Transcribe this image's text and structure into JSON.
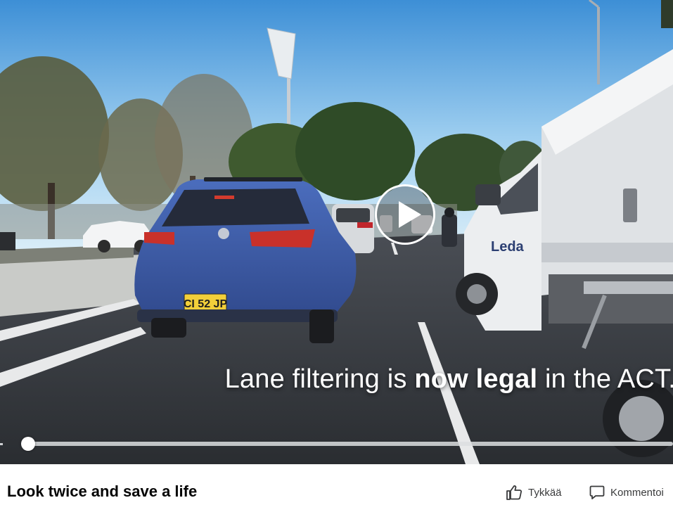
{
  "video": {
    "caption_prefix": "Lane filtering is ",
    "caption_bold": "now legal",
    "caption_suffix": " in the ACT.",
    "number_plate": "CI 52 JP",
    "truck_brand": "Leda",
    "progress": 0.0
  },
  "post": {
    "title": "Look twice and save a life",
    "like_label": "Tykkää",
    "comment_label": "Kommentoi"
  },
  "colors": {
    "sky_top": "#3d8fd6",
    "road": "#34373c",
    "car_blue": "#3e5eae",
    "truck_white": "#eceef0",
    "text_dark": "#050505",
    "action_gray": "#3a3b3c"
  },
  "icons": {
    "play": "play-icon",
    "like": "thumbs-up-icon",
    "comment": "comment-bubble-icon"
  }
}
